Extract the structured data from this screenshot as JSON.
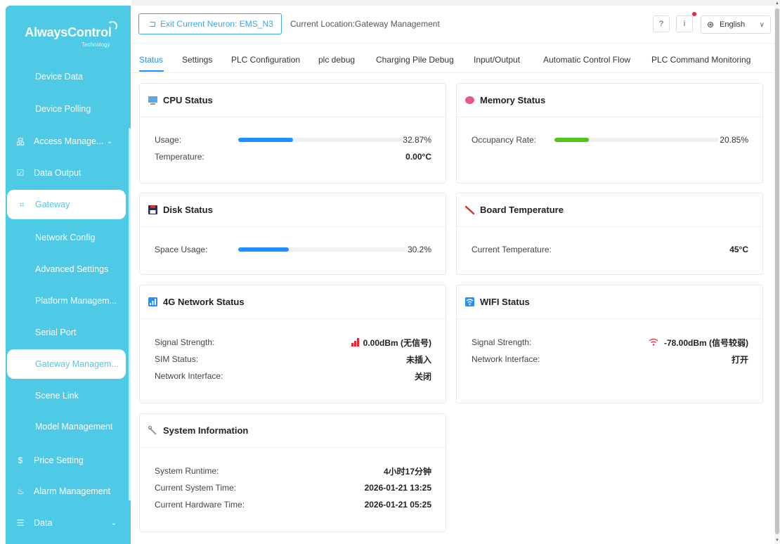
{
  "brand": {
    "name": "AlwaysControl",
    "sub": "Technology"
  },
  "sidebar": {
    "items": [
      {
        "label": "Device Data",
        "icon": "none"
      },
      {
        "label": "Device Polling",
        "icon": "none"
      },
      {
        "label": "Access Manage...",
        "icon": "sitemap-icon"
      },
      {
        "label": "Data Output",
        "icon": "external-icon"
      },
      {
        "label": "Gateway",
        "icon": "gateway-icon"
      },
      {
        "label": "Network Config",
        "icon": "none"
      },
      {
        "label": "Advanced Settings",
        "icon": "none"
      },
      {
        "label": "Platform Managem...",
        "icon": "none"
      },
      {
        "label": "Serial Port",
        "icon": "none"
      },
      {
        "label": "Gateway Managem...",
        "icon": "none"
      },
      {
        "label": "Scene Link",
        "icon": "none"
      },
      {
        "label": "Model Management",
        "icon": "none"
      },
      {
        "label": "Price Setting",
        "icon": "dollar-icon"
      },
      {
        "label": "Alarm Management",
        "icon": "alarm-icon"
      },
      {
        "label": "Data",
        "icon": "list-icon"
      }
    ]
  },
  "header": {
    "exit_label": "Exit Current Neuron: EMS_N3",
    "location": "Current Location:Gateway Management",
    "language": "English"
  },
  "tabs": [
    "Status",
    "Settings",
    "PLC Configuration",
    "plc debug",
    "Charging Pile Debug",
    "Input/Output",
    "Automatic Control Flow",
    "PLC Command Monitoring"
  ],
  "cpu": {
    "title": "CPU Status",
    "usage_label": "Usage:",
    "usage_value": "32.87%",
    "usage_fraction": 0.3287,
    "temp_label": "Temperature:",
    "temp_value": "0.00°C"
  },
  "memory": {
    "title": "Memory Status",
    "occupancy_label": "Occupancy Rate:",
    "occupancy_value": "20.85%",
    "occupancy_fraction": 0.2085
  },
  "disk": {
    "title": "Disk Status",
    "space_label": "Space Usage:",
    "space_value": "30.2%",
    "space_fraction": 0.302
  },
  "board": {
    "title": "Board Temperature",
    "temp_label": "Current Temperature:",
    "temp_value": "45°C"
  },
  "network4g": {
    "title": "4G Network Status",
    "signal_label": "Signal Strength:",
    "signal_value": "0.00dBm (无信号)",
    "sim_label": "SIM Status:",
    "sim_value": "未插入",
    "iface_label": "Network Interface:",
    "iface_value": "关闭"
  },
  "wifi": {
    "title": "WIFI Status",
    "signal_label": "Signal Strength:",
    "signal_value": "-78.00dBm (信号较弱)",
    "iface_label": "Network Interface:",
    "iface_value": "打开"
  },
  "system": {
    "title": "System Information",
    "runtime_label": "System Runtime:",
    "runtime_value": "4小时17分钟",
    "systime_label": "Current System Time:",
    "systime_value": "2026-01-21 13:25",
    "hwtime_label": "Current Hardware Time:",
    "hwtime_value": "2026-01-21 05:25"
  },
  "colors": {
    "sidebar": "#4ec9e6",
    "accent": "#1e90ff",
    "bar_blue": "#1e90ff",
    "bar_green": "#52c41a",
    "danger": "#f5222d"
  }
}
